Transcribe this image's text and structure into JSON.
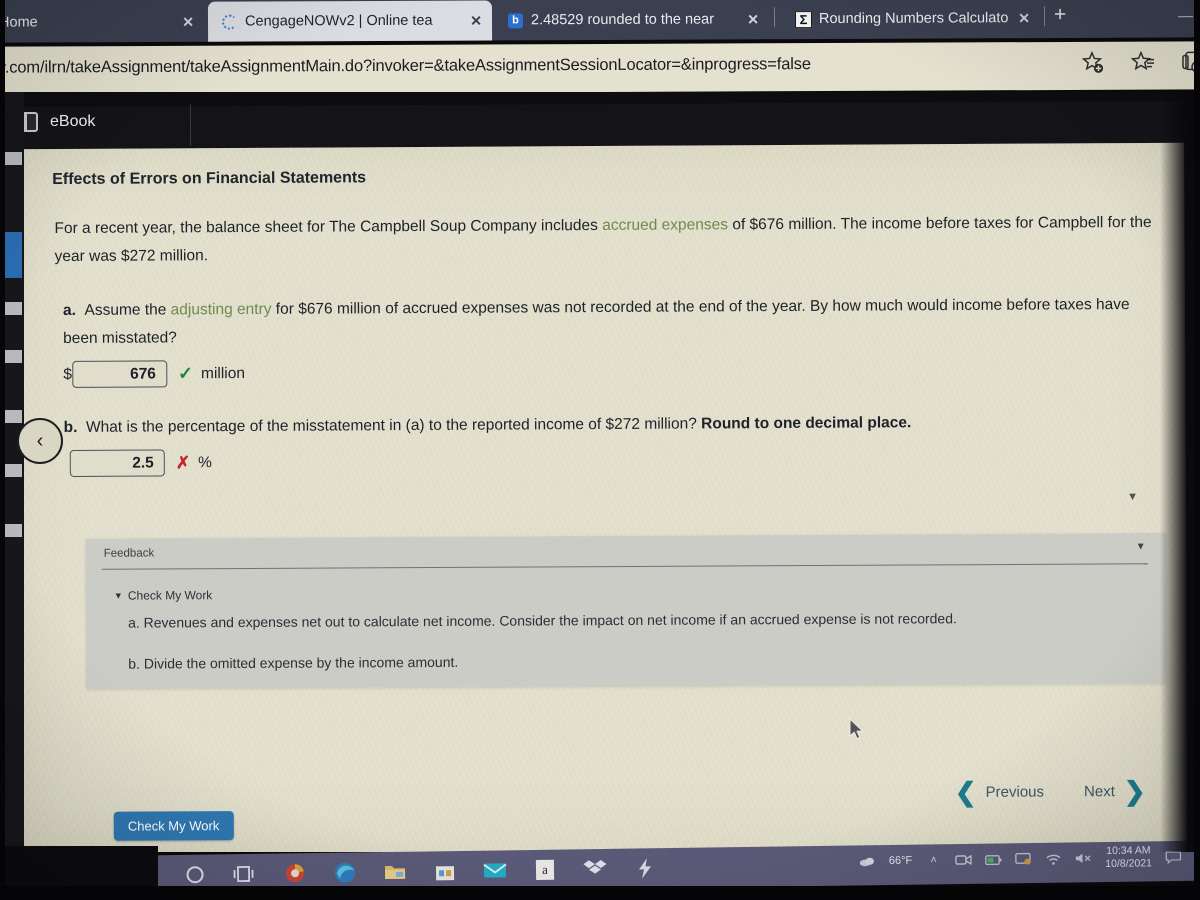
{
  "browser": {
    "tabs": [
      {
        "title": "Home",
        "icon": "none",
        "active": false
      },
      {
        "title": "CengageNOWv2 | Online tea",
        "icon": "loading-spinner-icon",
        "active": true
      },
      {
        "title": "2.48529 rounded to the near",
        "icon": "brainly-icon",
        "active": false
      },
      {
        "title": "Rounding Numbers Calculato",
        "icon": "sigma-icon",
        "active": false
      }
    ],
    "new_tab_label": "+",
    "minimize_label": "—",
    "url": "w.com/ilrn/takeAssignment/takeAssignmentMain.do?invoker=&takeAssignmentSessionLocator=&inprogress=false",
    "toolbar_icons": [
      "add-favorite-icon",
      "favorites-list-icon",
      "collections-icon"
    ]
  },
  "app": {
    "topbar": {
      "ebook_label": "eBook",
      "ebook_icon": "book-icon"
    },
    "collapse_button_label": "‹",
    "scroll_caret": "▼"
  },
  "question": {
    "title": "Effects of Errors on Financial Statements",
    "intro_part1": "For a recent year, the balance sheet for The Campbell Soup Company includes ",
    "intro_link": "accrued expenses",
    "intro_part2": " of $676 million. The income before taxes for Campbell for the year was $272 million.",
    "parts": [
      {
        "label": "a.",
        "text_part1": "Assume the ",
        "link": "adjusting entry",
        "text_part2": " for $676 million of accrued expenses was not recorded at the end of the year. By how much would income before taxes have been misstated?",
        "prefix": "$",
        "value": "676",
        "mark": "✓",
        "mark_state": "correct",
        "suffix": "million"
      },
      {
        "label": "b.",
        "text_part1": "What is the percentage of the misstatement in (a) to the reported income of $272 million? ",
        "bold_text": "Round to one decimal place.",
        "prefix": "",
        "value": "2.5",
        "mark": "✗",
        "mark_state": "incorrect",
        "suffix": "%"
      }
    ]
  },
  "feedback": {
    "label": "Feedback",
    "caret": "▼",
    "check_my_work_toggle": "Check My Work",
    "toggle_caret": "▼",
    "lines": [
      "a. Revenues and expenses net out to calculate net income. Consider the impact on net income if an accrued expense is not recorded.",
      "b. Divide the omitted expense by the income amount."
    ]
  },
  "footer": {
    "previous_label": "Previous",
    "previous_chevron": "❮",
    "next_label": "Next",
    "next_chevron": "❯",
    "check_my_work_button": "Check My Work"
  },
  "taskbar": {
    "icons": [
      "cortana-circle-icon",
      "task-view-icon",
      "chrome-icon",
      "edge-icon",
      "file-explorer-icon",
      "microsoft-store-icon",
      "mail-icon",
      "amazon-icon",
      "dropbox-icon",
      "lightning-icon"
    ],
    "tray": {
      "weather_icon": "cloud-icon",
      "temperature": "66°F",
      "overflow_chevron": "˄",
      "icons": [
        "camera-icon",
        "battery-icon",
        "display-icon",
        "wifi-icon",
        "speaker-muted-icon"
      ],
      "time": "10:34 AM",
      "date": "10/8/2021",
      "action_center_icon": "notification-icon"
    }
  },
  "colors": {
    "accent_blue": "#2e78b1",
    "link_green": "#6f8a4e",
    "correct_green": "#1f8a3b",
    "incorrect_red": "#c32828",
    "nav_teal": "#1d7b8e",
    "paper_bg": "#dfdcc8",
    "dark_bar": "#141317"
  }
}
